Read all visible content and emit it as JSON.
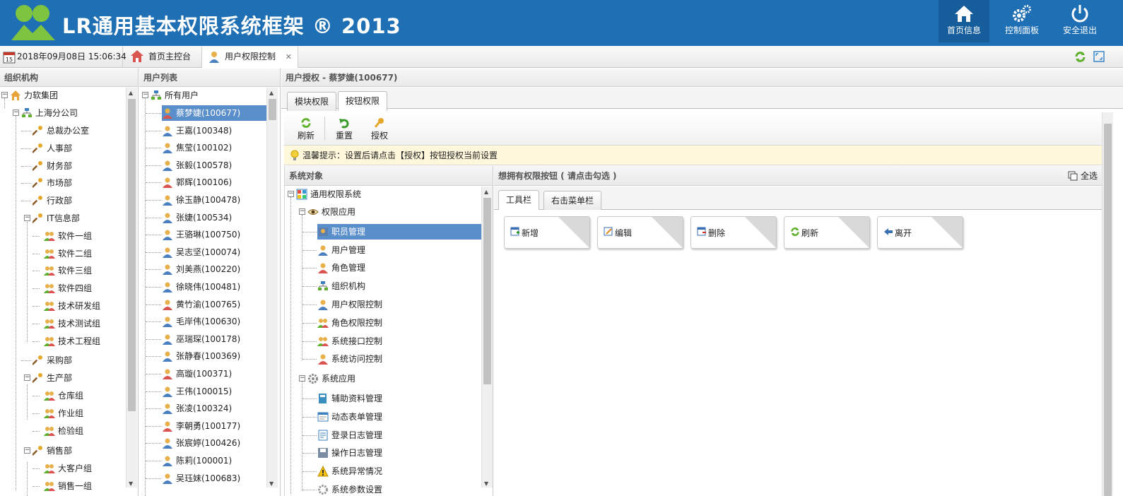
{
  "header": {
    "title": "LR通用基本权限系统框架 ® 2013",
    "buttons": [
      {
        "label": "首页信息",
        "icon": "home-icon",
        "active": true
      },
      {
        "label": "控制面板",
        "icon": "gear-icon",
        "active": false
      },
      {
        "label": "安全退出",
        "icon": "power-icon",
        "active": false
      }
    ]
  },
  "tabbar": {
    "datetime": "2018年09月08日 15:06:34",
    "calendar_day": "15",
    "tabs": [
      {
        "label": "首页主控台",
        "icon": "home-icon"
      },
      {
        "label": "用户权限控制",
        "icon": "user-icon",
        "active": true
      }
    ],
    "close_glyph": "✕"
  },
  "org": {
    "title": "组织机构",
    "root": "力软集团",
    "branch": "上海分公司",
    "items": [
      {
        "label": "总裁办公室",
        "level": 2
      },
      {
        "label": "人事部",
        "level": 2
      },
      {
        "label": "财务部",
        "level": 2
      },
      {
        "label": "市场部",
        "level": 2
      },
      {
        "label": "行政部",
        "level": 2
      },
      {
        "label": "IT信息部",
        "level": 2,
        "expanded": true
      },
      {
        "label": "软件一组",
        "level": 3
      },
      {
        "label": "软件二组",
        "level": 3
      },
      {
        "label": "软件三组",
        "level": 3
      },
      {
        "label": "软件四组",
        "level": 3
      },
      {
        "label": "技术研发组",
        "level": 3
      },
      {
        "label": "技术测试组",
        "level": 3
      },
      {
        "label": "技术工程组",
        "level": 3
      },
      {
        "label": "采购部",
        "level": 2
      },
      {
        "label": "生产部",
        "level": 2,
        "expanded": true
      },
      {
        "label": "仓库组",
        "level": 3
      },
      {
        "label": "作业组",
        "level": 3
      },
      {
        "label": "检验组",
        "level": 3
      },
      {
        "label": "销售部",
        "level": 2,
        "expanded": true
      },
      {
        "label": "大客户组",
        "level": 3
      },
      {
        "label": "销售一组",
        "level": 3
      }
    ]
  },
  "users": {
    "title": "用户列表",
    "root": "所有用户",
    "items": [
      {
        "label": "蔡梦婕(100677)",
        "female": true
      },
      {
        "label": "王嘉(100348)"
      },
      {
        "label": "焦莹(100102)"
      },
      {
        "label": "张毅(100578)"
      },
      {
        "label": "郭辉(100106)",
        "female": true
      },
      {
        "label": "徐玉静(100478)"
      },
      {
        "label": "张婕(100534)"
      },
      {
        "label": "王骆琳(100750)"
      },
      {
        "label": "吴志坚(100074)"
      },
      {
        "label": "刘美燕(100220)"
      },
      {
        "label": "徐晓伟(100481)"
      },
      {
        "label": "黄竹渝(100765)",
        "female": true
      },
      {
        "label": "毛岸伟(100630)"
      },
      {
        "label": "巫瑞琛(100178)"
      },
      {
        "label": "张静春(100369)"
      },
      {
        "label": "高璇(100371)",
        "female": true
      },
      {
        "label": "王伟(100015)"
      },
      {
        "label": "张凌(100324)"
      },
      {
        "label": "李朝勇(100177)",
        "female": true
      },
      {
        "label": "张宸婷(100426)"
      },
      {
        "label": "陈莉(100001)"
      },
      {
        "label": "吴珏妹(100683)"
      }
    ]
  },
  "auth": {
    "title": "用户授权 - 蔡梦婕(100677)",
    "tabs": [
      "模块权限",
      "按钮权限"
    ],
    "toolbar": [
      "刷新",
      "重置",
      "授权"
    ],
    "tip": "温馨提示：设置后请点击【授权】按钮授权当前设置",
    "sys_title": "系统对象",
    "sys_root": "通用权限系统",
    "groups": [
      {
        "label": "权限应用",
        "children": [
          "职员管理",
          "用户管理",
          "角色管理",
          "组织机构",
          "用户权限控制",
          "角色权限控制",
          "系统接口控制",
          "系统访问控制"
        ]
      },
      {
        "label": "系统应用",
        "children": [
          "辅助资料管理",
          "动态表单管理",
          "登录日志管理",
          "操作日志管理",
          "系统异常情况",
          "系统参数设置"
        ]
      }
    ],
    "btn_title": "想拥有权限按钮 ( 请点击勾选 )",
    "select_all": "全选",
    "btn_tabs": [
      "工具栏",
      "右击菜单栏"
    ],
    "buttons": [
      "新增",
      "编辑",
      "删除",
      "刷新",
      "离开"
    ]
  },
  "colors": {
    "header": "#1e6fb4",
    "selected": "#5b8fcc",
    "tip_bg": "#fff8dc"
  }
}
